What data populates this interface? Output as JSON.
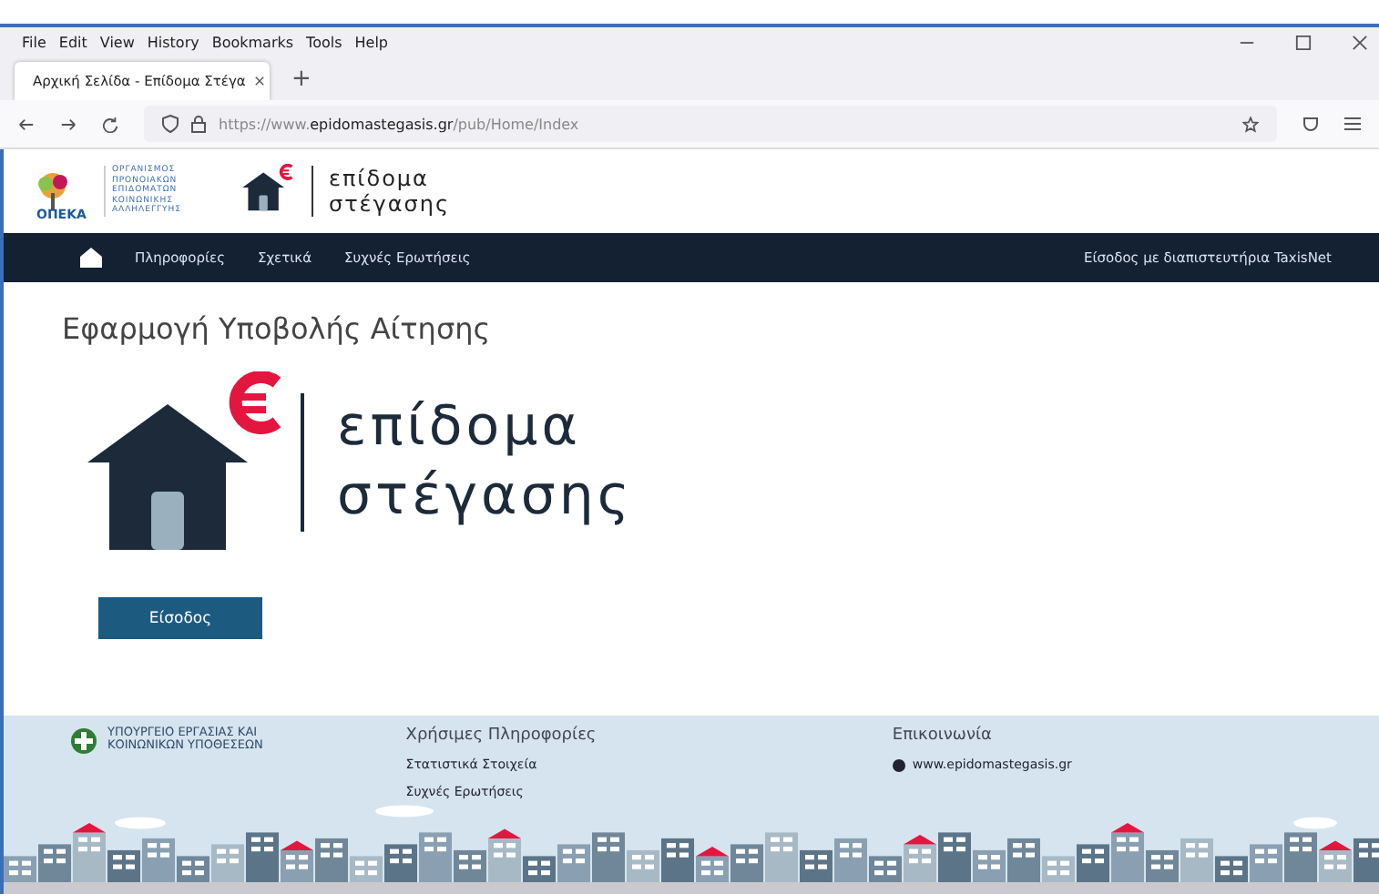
{
  "browser": {
    "menu": [
      "File",
      "Edit",
      "View",
      "History",
      "Bookmarks",
      "Tools",
      "Help"
    ],
    "tabs": [
      {
        "label": "Αρχική Σελίδα - Επίδομα Στέγα",
        "selected": true
      }
    ],
    "new_tab": "+",
    "url": {
      "prefix": "https://www.",
      "domain": "epidomastegasis.gr",
      "path": "/pub/Home/Index"
    }
  },
  "header": {
    "org_lines": [
      "ΟΡΓΑΝΙΣΜΟΣ",
      "ΠΡΟΝΟΙΑΚΩΝ",
      "ΕΠΙΔΟΜΑΤΩΝ",
      "ΚΟΙΝΩΝΙΚΗΣ",
      "ΑΛΛΗΛΕΓΓΥΗΣ"
    ],
    "org_short": "ΟΠΕΚΑ",
    "brand_lines": [
      "επίδομα",
      "στέγασης"
    ]
  },
  "nav": {
    "items": [
      "Πληροφορίες",
      "Σχετικά",
      "Συχνές Ερωτήσεις"
    ],
    "login": "Είσοδος με διαπιστευτήρια TaxisNet"
  },
  "main": {
    "title": "Εφαρμογή Υποβολής Αίτησης",
    "brand_lines": [
      "επίδομα",
      "στέγασης"
    ],
    "button": "Είσοδος"
  },
  "footer": {
    "ministry": [
      "ΥΠΟΥΡΓΕΙΟ ΕΡΓΑΣΙΑΣ ΚΑΙ",
      "ΚΟΙΝΩΝΙΚΩΝ ΥΠΟΘΕΣΕΩΝ"
    ],
    "info_title": "Χρήσιμες Πληροφορίες",
    "info_links": [
      "Στατιστικά Στοιχεία",
      "Συχνές Ερωτήσεις"
    ],
    "contact_title": "Επικοινωνία",
    "contact_link": "www.epidomastegasis.gr"
  }
}
